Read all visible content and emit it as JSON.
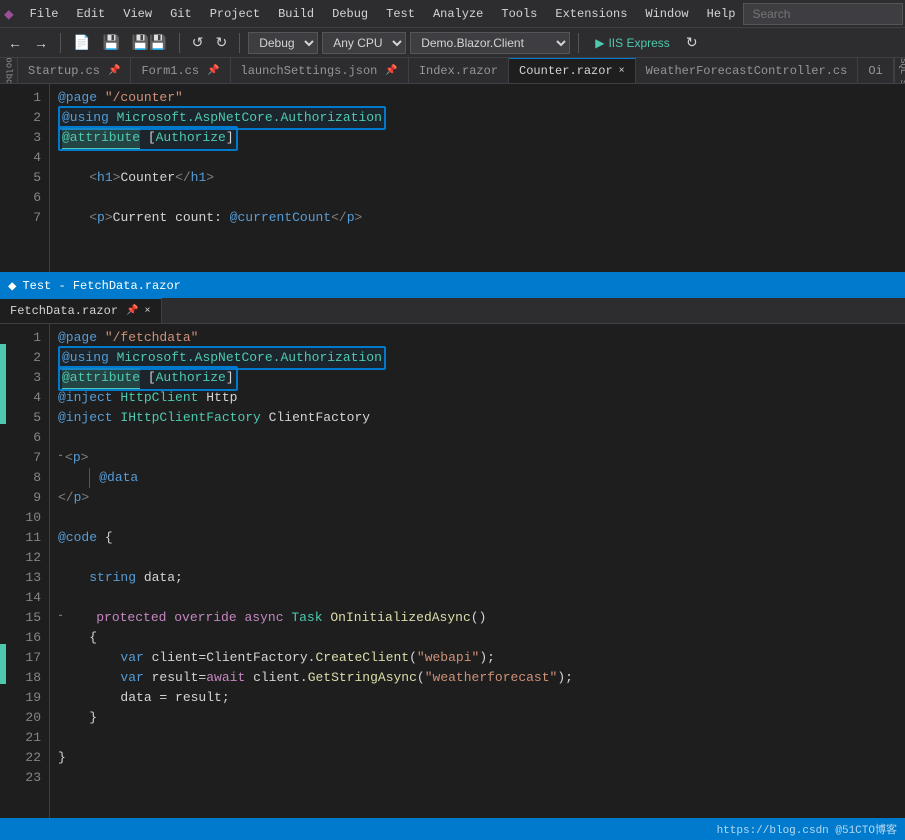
{
  "menubar": {
    "logo": "VS",
    "items": [
      "File",
      "Edit",
      "View",
      "Git",
      "Project",
      "Build",
      "Debug",
      "Test",
      "Analyze",
      "Tools",
      "Extensions",
      "Window",
      "Help"
    ],
    "search_placeholder": "Search"
  },
  "toolbar": {
    "debug_config": "Debug",
    "cpu": "Any CPU",
    "project": "Demo.Blazor.Client",
    "run_label": "IIS Express"
  },
  "tabs_top": {
    "side_label": "Toolbox  SQL Server Object",
    "tabs": [
      {
        "label": "Startup.cs",
        "pin": "×",
        "active": false
      },
      {
        "label": "Form1.cs",
        "pin": "×",
        "active": false
      },
      {
        "label": "launchSettings.json",
        "pin": "×",
        "active": false
      },
      {
        "label": "Index.razor",
        "active": false
      },
      {
        "label": "Counter.razor",
        "pin": "×",
        "active": true
      },
      {
        "label": "WeatherForecastController.cs",
        "active": false
      },
      {
        "label": "Oi",
        "active": false
      }
    ]
  },
  "counter_razor": {
    "lines": [
      {
        "num": 1,
        "content": "@page \"/counter\"",
        "indicator": false
      },
      {
        "num": 2,
        "content": "@using Microsoft.AspNetCore.Authorization",
        "indicator": false,
        "highlighted": true
      },
      {
        "num": 3,
        "content": "@attribute [Authorize]",
        "indicator": false,
        "highlighted": true
      },
      {
        "num": 4,
        "content": "",
        "indicator": false
      },
      {
        "num": 5,
        "content": "    <h1>Counter</h1>",
        "indicator": false
      },
      {
        "num": 6,
        "content": "",
        "indicator": false
      },
      {
        "num": 7,
        "content": "    <p>Current count: @currentCount</p>",
        "indicator": false
      }
    ]
  },
  "window_title": "Test - FetchData.razor",
  "fetchdata_tab": {
    "label": "FetchData.razor",
    "pin": "×"
  },
  "fetchdata_razor": {
    "lines": [
      {
        "num": 1,
        "content": "@page \"/fetchdata\"",
        "indicator": false
      },
      {
        "num": 2,
        "content": "@using Microsoft.AspNetCore.Authorization",
        "indicator": true,
        "highlighted": true
      },
      {
        "num": 3,
        "content": "@attribute [Authorize]",
        "indicator": true,
        "highlighted": true
      },
      {
        "num": 4,
        "content": "@inject HttpClient Http",
        "indicator": true
      },
      {
        "num": 5,
        "content": "@inject IHttpClientFactory ClientFactory",
        "indicator": true
      },
      {
        "num": 6,
        "content": "",
        "indicator": false
      },
      {
        "num": 7,
        "content": "<p>",
        "indicator": false,
        "collapsible": true
      },
      {
        "num": 8,
        "content": "    @data",
        "indicator": false
      },
      {
        "num": 9,
        "content": "</p>",
        "indicator": false,
        "indent": 0
      },
      {
        "num": 10,
        "content": "",
        "indicator": false
      },
      {
        "num": 11,
        "content": "@code {",
        "indicator": false
      },
      {
        "num": 12,
        "content": "",
        "indicator": false
      },
      {
        "num": 13,
        "content": "    string data;",
        "indicator": false
      },
      {
        "num": 14,
        "content": "",
        "indicator": false
      },
      {
        "num": 15,
        "content": "    protected override async Task OnInitializedAsync()",
        "indicator": false,
        "collapsible": true
      },
      {
        "num": 16,
        "content": "    {",
        "indicator": false
      },
      {
        "num": 17,
        "content": "        var client=ClientFactory.CreateClient(\"webapi\");",
        "indicator": true
      },
      {
        "num": 18,
        "content": "        var result=await client.GetStringAsync(\"weatherforecast\");",
        "indicator": true
      },
      {
        "num": 19,
        "content": "        data = result;",
        "indicator": false
      },
      {
        "num": 20,
        "content": "    }",
        "indicator": false
      },
      {
        "num": 21,
        "content": "",
        "indicator": false
      },
      {
        "num": 22,
        "content": "}",
        "indicator": false
      },
      {
        "num": 23,
        "content": "",
        "indicator": false
      }
    ]
  },
  "bottom_bar": {
    "watermark": "https://blog.csdn  @51CTO博客"
  }
}
